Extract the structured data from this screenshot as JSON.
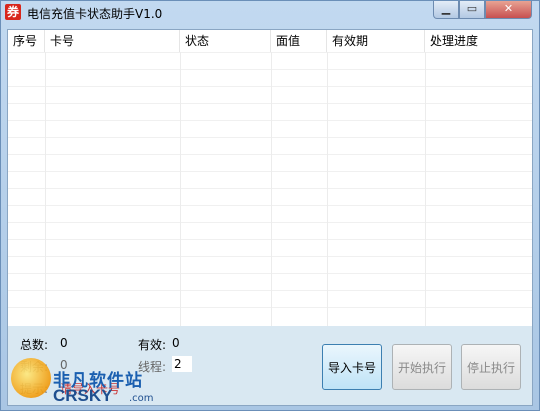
{
  "window": {
    "title": "电信充值卡状态助手V1.0",
    "icon_glyph": "券"
  },
  "listview": {
    "columns": [
      "序号",
      "卡号",
      "状态",
      "面值",
      "有效期",
      "处理进度"
    ],
    "rows": []
  },
  "status": {
    "total_label": "总数:",
    "total_value": "0",
    "valid_label": "有效:",
    "valid_value": "0",
    "remaining_label": "剩余:",
    "remaining_value": "0",
    "threads_label": "线程:",
    "threads_value": "2",
    "hint_label": "提示:",
    "hint_value": "请导入卡号"
  },
  "buttons": {
    "import": "导入卡号",
    "start": "开始执行",
    "stop": "停止执行"
  },
  "watermark": {
    "cn": "非凡软件站",
    "en": "CRSKY",
    "suffix": ".com"
  },
  "colors": {
    "accent": "#3c7fb1",
    "panel": "#d9e8f2",
    "close": "#c75050"
  }
}
